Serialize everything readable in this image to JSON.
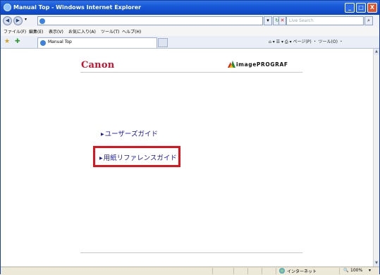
{
  "window": {
    "title": "Manual Top - Windows Internet Explorer",
    "controls": [
      "_",
      "□",
      "X"
    ]
  },
  "address_bar": {
    "url": "",
    "search_placeholder": "Live Search"
  },
  "menu_bar": {
    "items": [
      "ファイル(F)",
      "編集(E)",
      "表示(V)",
      "お気に入り(A)",
      "ツール(T)",
      "ヘルプ(H)"
    ]
  },
  "tab_bar": {
    "tabs": [
      {
        "label": "Manual Top"
      }
    ],
    "command_bar": "ページ(P) ・ ツール(O) ・"
  },
  "page": {
    "brand_logo": "Canon",
    "product_logo": "imagePROGRAF",
    "links": [
      {
        "label": "ユーザーズガイド",
        "highlighted": false
      },
      {
        "label": "用紙リファレンスガイド",
        "highlighted": true
      }
    ],
    "link_color": "#1a1aa8",
    "highlight_color": "#e0131c"
  },
  "status_bar": {
    "zone": "インターネット",
    "zoom": "100%"
  }
}
